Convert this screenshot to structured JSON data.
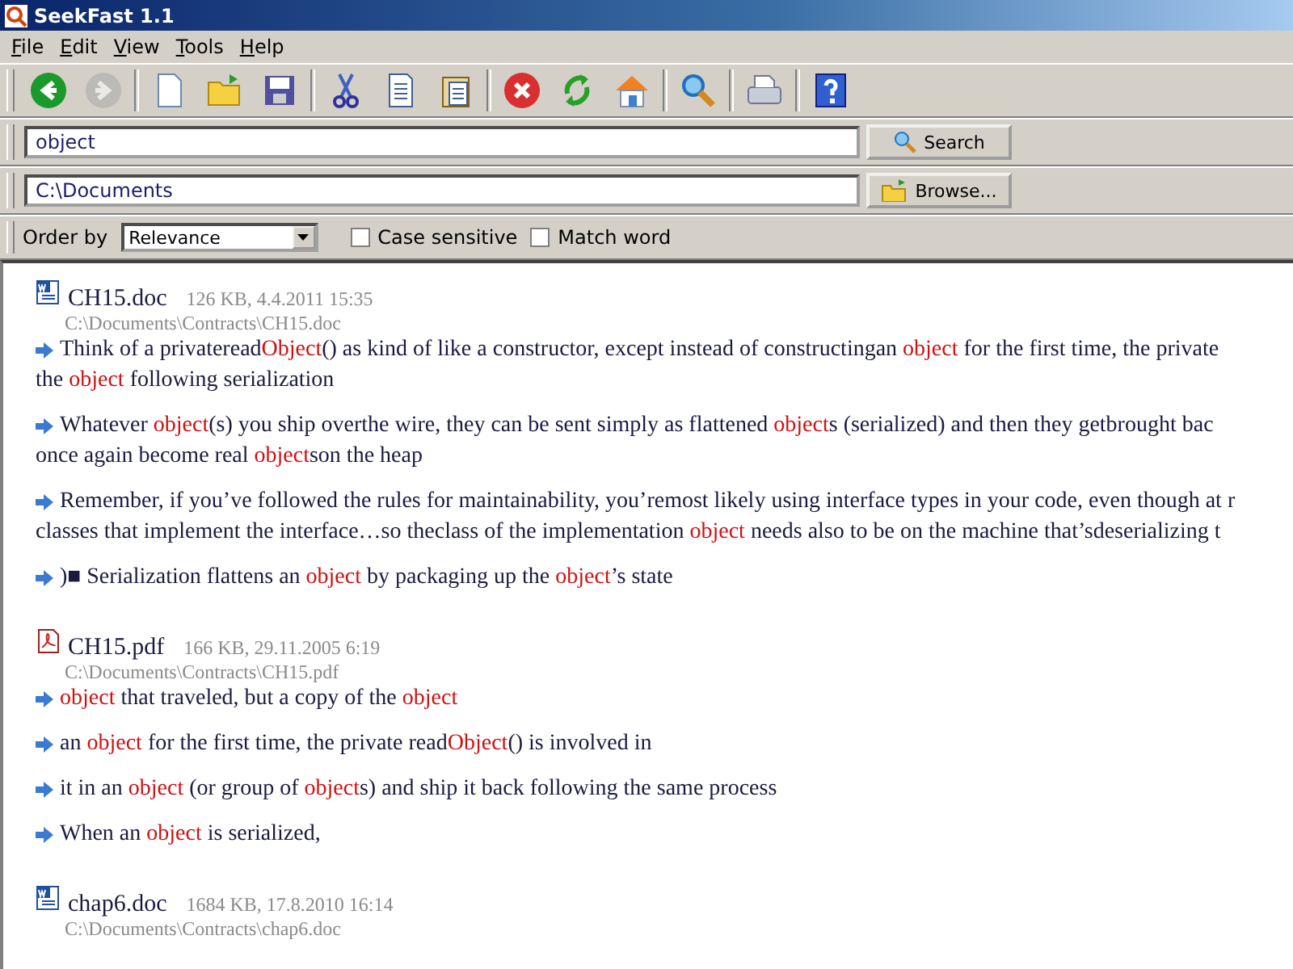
{
  "window": {
    "title": "SeekFast 1.1"
  },
  "menu": [
    {
      "label": "File"
    },
    {
      "label": "Edit"
    },
    {
      "label": "View"
    },
    {
      "label": "Tools"
    },
    {
      "label": "Help"
    }
  ],
  "toolbar": [
    {
      "kind": "back",
      "disabled": false
    },
    {
      "kind": "forward",
      "disabled": true
    },
    {
      "kind": "sep"
    },
    {
      "kind": "new",
      "disabled": false
    },
    {
      "kind": "open",
      "disabled": false
    },
    {
      "kind": "save",
      "disabled": false
    },
    {
      "kind": "sep"
    },
    {
      "kind": "cut",
      "disabled": false
    },
    {
      "kind": "copy",
      "disabled": false
    },
    {
      "kind": "paste",
      "disabled": false
    },
    {
      "kind": "sep"
    },
    {
      "kind": "stop",
      "disabled": false
    },
    {
      "kind": "refresh",
      "disabled": false
    },
    {
      "kind": "home",
      "disabled": false
    },
    {
      "kind": "sep"
    },
    {
      "kind": "search",
      "disabled": false
    },
    {
      "kind": "sep"
    },
    {
      "kind": "print",
      "disabled": false
    },
    {
      "kind": "sep"
    },
    {
      "kind": "help",
      "disabled": false
    }
  ],
  "search": {
    "value": "object",
    "button": "Search"
  },
  "folder": {
    "value": "C:\\Documents",
    "button": "Browse..."
  },
  "options": {
    "order_label": "Order by",
    "order_value": "Relevance",
    "case_sensitive": {
      "label": "Case sensitive",
      "checked": false
    },
    "match_word": {
      "label": "Match word",
      "checked": false
    }
  },
  "results": [
    {
      "kind": "doc",
      "name": "CH15.doc",
      "meta": "126 KB, 4.4.2011 15:35",
      "path": "C:\\Documents\\Contracts\\CH15.doc",
      "snippets": [
        [
          [
            {
              "text": "Think of a privateread",
              "hit": false
            },
            {
              "text": "Object",
              "hit": true
            },
            {
              "text": "() as kind of like a constructor, except instead of constructingan ",
              "hit": false
            },
            {
              "text": "object",
              "hit": true
            },
            {
              "text": " for the first time, the private",
              "hit": false
            }
          ],
          [
            {
              "text": "the ",
              "hit": false
            },
            {
              "text": "object",
              "hit": true
            },
            {
              "text": " following serialization",
              "hit": false
            }
          ]
        ],
        [
          [
            {
              "text": "Whatever ",
              "hit": false
            },
            {
              "text": "object",
              "hit": true
            },
            {
              "text": "(s) you ship overthe wire, they can be sent simply as flattened ",
              "hit": false
            },
            {
              "text": "object",
              "hit": true
            },
            {
              "text": "s (serialized) and then they getbrought bac",
              "hit": false
            }
          ],
          [
            {
              "text": "once again become real ",
              "hit": false
            },
            {
              "text": "object",
              "hit": true
            },
            {
              "text": "son the heap",
              "hit": false
            }
          ]
        ],
        [
          [
            {
              "text": "Remember, if you’ve followed the rules for maintainability, you’remost likely using interface types in your code, even though at r",
              "hit": false
            }
          ],
          [
            {
              "text": "classes that implement the interface…so theclass of the implementation ",
              "hit": false
            },
            {
              "text": "object",
              "hit": true
            },
            {
              "text": " needs also to be on the machine that’sdeserializing t",
              "hit": false
            }
          ]
        ],
        [
          [
            {
              "text": ")■ Serialization flattens an ",
              "hit": false
            },
            {
              "text": "object",
              "hit": true
            },
            {
              "text": " by packaging up the ",
              "hit": false
            },
            {
              "text": "object",
              "hit": true
            },
            {
              "text": "’s state",
              "hit": false
            }
          ]
        ]
      ]
    },
    {
      "kind": "pdf",
      "name": "CH15.pdf",
      "meta": "166 KB, 29.11.2005 6:19",
      "path": "C:\\Documents\\Contracts\\CH15.pdf",
      "snippets": [
        [
          [
            {
              "text": "object",
              "hit": true
            },
            {
              "text": " that traveled, but a copy of the ",
              "hit": false
            },
            {
              "text": "object",
              "hit": true
            }
          ]
        ],
        [
          [
            {
              "text": "an ",
              "hit": false
            },
            {
              "text": "object",
              "hit": true
            },
            {
              "text": " for the first time, the private read",
              "hit": false
            },
            {
              "text": "Object",
              "hit": true
            },
            {
              "text": "() is involved in",
              "hit": false
            }
          ]
        ],
        [
          [
            {
              "text": "it in an ",
              "hit": false
            },
            {
              "text": "object",
              "hit": true
            },
            {
              "text": " (or group of ",
              "hit": false
            },
            {
              "text": "object",
              "hit": true
            },
            {
              "text": "s) and ship it back following the same process",
              "hit": false
            }
          ]
        ],
        [
          [
            {
              "text": "When an ",
              "hit": false
            },
            {
              "text": "object",
              "hit": true
            },
            {
              "text": " is serialized,",
              "hit": false
            }
          ]
        ]
      ]
    },
    {
      "kind": "doc",
      "name": "chap6.doc",
      "meta": "1684 KB, 17.8.2010 16:14",
      "path": "C:\\Documents\\Contracts\\chap6.doc"
    }
  ]
}
